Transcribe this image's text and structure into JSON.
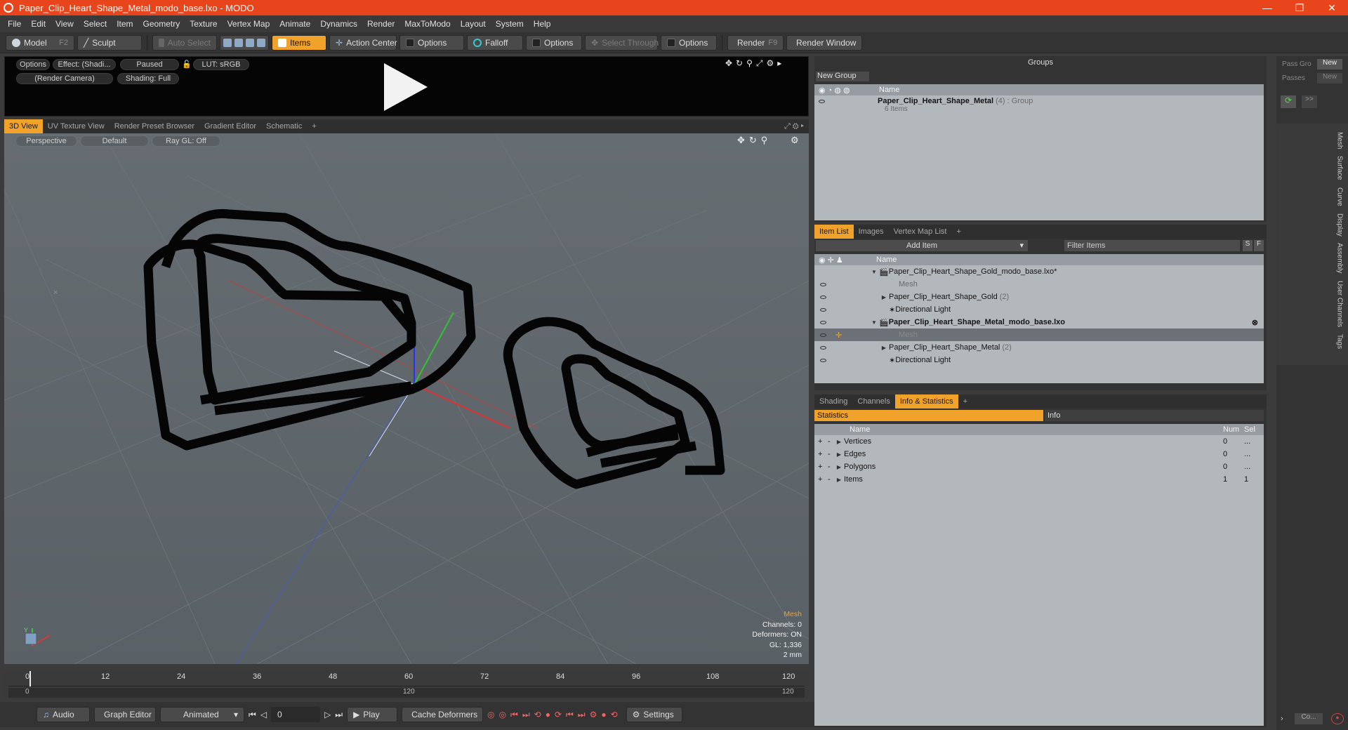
{
  "window": {
    "title": "Paper_Clip_Heart_Shape_Metal_modo_base.lxo - MODO"
  },
  "menu": [
    "File",
    "Edit",
    "View",
    "Select",
    "Item",
    "Geometry",
    "Texture",
    "Vertex Map",
    "Animate",
    "Dynamics",
    "Render",
    "MaxToModo",
    "Layout",
    "System",
    "Help"
  ],
  "toolbar": {
    "model": "Model",
    "model_key": "F2",
    "sculpt": "Sculpt",
    "auto_select": "Auto Select",
    "items": "Items",
    "action_center": "Action Center",
    "options1": "Options",
    "falloff": "Falloff",
    "options2": "Options",
    "select_through": "Select Through",
    "options3": "Options",
    "render": "Render",
    "render_key": "F9",
    "render_window": "Render Window"
  },
  "preview": {
    "options": "Options",
    "effect": "Effect: (Shadi...",
    "paused": "Paused",
    "lut": "LUT: sRGB",
    "camera": "(Render Camera)",
    "shading": "Shading: Full"
  },
  "view_tabs": [
    "3D View",
    "UV Texture View",
    "Render Preset Browser",
    "Gradient Editor",
    "Schematic"
  ],
  "viewport": {
    "perspective": "Perspective",
    "default": "Default",
    "raygl": "Ray GL: Off",
    "info": {
      "mesh": "Mesh",
      "channels": "Channels: 0",
      "deformers": "Deformers: ON",
      "gl": "GL: 1,336",
      "unit": "2 mm"
    },
    "axis_y": "Y"
  },
  "timeline": {
    "ticks": [
      "0",
      "12",
      "24",
      "36",
      "48",
      "60",
      "72",
      "84",
      "96",
      "108",
      "120"
    ],
    "range_start": "0",
    "range_mid": "120",
    "range_end": "120"
  },
  "bottom": {
    "audio": "Audio",
    "graph_editor": "Graph Editor",
    "animated": "Animated",
    "frame": "0",
    "play": "Play",
    "cache_deformers": "Cache Deformers",
    "settings": "Settings"
  },
  "groups": {
    "title": "Groups",
    "new_group": "New Group",
    "col_name": "Name",
    "group_name": "Paper_Clip_Heart_Shape_Metal",
    "group_count": "(4)",
    "group_type": ": Group",
    "group_items": "6 Items"
  },
  "pass": {
    "pass_groups": "Pass Gro",
    "new1": "New",
    "passes": "Passes",
    "new2": "New",
    "more": ">>"
  },
  "item_list": {
    "tabs": [
      "Item List",
      "Images",
      "Vertex Map List"
    ],
    "add_item": "Add Item",
    "filter": "Filter Items",
    "s": "S",
    "f": "F",
    "col_name": "Name",
    "rows": [
      {
        "label": "Paper_Clip_Heart_Shape_Gold_modo_base.lxo*",
        "indent": 0,
        "bold": false
      },
      {
        "label": "Mesh",
        "indent": 2,
        "bold": false
      },
      {
        "label": "Paper_Clip_Heart_Shape_Gold",
        "count": "(2)",
        "indent": 1,
        "bold": false
      },
      {
        "label": "Directional Light",
        "indent": 1,
        "bold": false
      },
      {
        "label": "Paper_Clip_Heart_Shape_Metal_modo_base.lxo",
        "indent": 0,
        "bold": true
      },
      {
        "label": "Mesh",
        "indent": 2,
        "bold": false
      },
      {
        "label": "Paper_Clip_Heart_Shape_Metal",
        "count": "(2)",
        "indent": 1,
        "bold": false
      },
      {
        "label": "Directional Light",
        "indent": 1,
        "bold": false
      }
    ]
  },
  "stats": {
    "tabs": [
      "Shading",
      "Channels",
      "Info & Statistics"
    ],
    "statistics": "Statistics",
    "info": "Info",
    "col_name": "Name",
    "col_num": "Num",
    "col_sel": "Sel",
    "rows": [
      {
        "name": "Vertices",
        "num": "0",
        "sel": "..."
      },
      {
        "name": "Edges",
        "num": "0",
        "sel": "..."
      },
      {
        "name": "Polygons",
        "num": "0",
        "sel": "..."
      },
      {
        "name": "Items",
        "num": "1",
        "sel": "1"
      }
    ]
  },
  "side_tabs": [
    "Mesh",
    "Surface",
    "Curve",
    "Display",
    "Assembly",
    "User Channels",
    "Tags"
  ],
  "corner": {
    "co": "Co..."
  },
  "colors": {
    "accent": "#f0a22a",
    "titlebar": "#e9451c"
  }
}
